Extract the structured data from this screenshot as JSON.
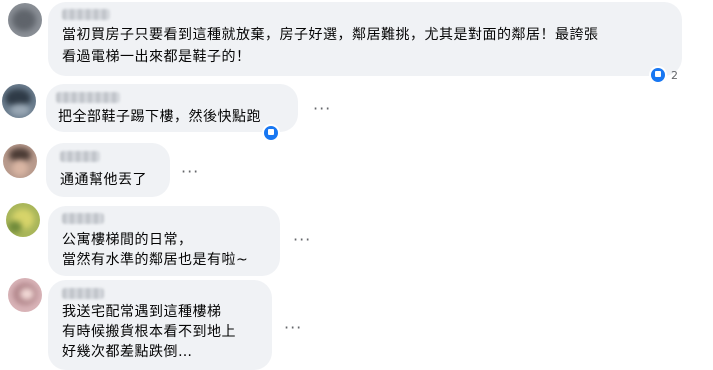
{
  "comments": [
    {
      "lines": [
        "當初買房子只要看到這種就放棄，房子好選，鄰居難挑，尤其是對面的鄰居！最誇張",
        "看過電梯一出來都是鞋子的！"
      ],
      "reaction_count": "2"
    },
    {
      "lines": [
        "把全部鞋子踢下樓，然後快點跑"
      ]
    },
    {
      "lines": [
        "通通幫他丟了"
      ]
    },
    {
      "lines": [
        "公寓樓梯間的日常，",
        "當然有水準的鄰居也是有啦~"
      ]
    },
    {
      "lines": [
        "我送宅配常遇到這種樓梯",
        "有時候搬貨根本看不到地上",
        "好幾次都差點跌倒…"
      ]
    }
  ],
  "more_icon_glyph": "···",
  "colors": {
    "bubble": "#f0f2f5",
    "text": "#050505",
    "secondary": "#65676b",
    "reaction": "#1877f2"
  }
}
